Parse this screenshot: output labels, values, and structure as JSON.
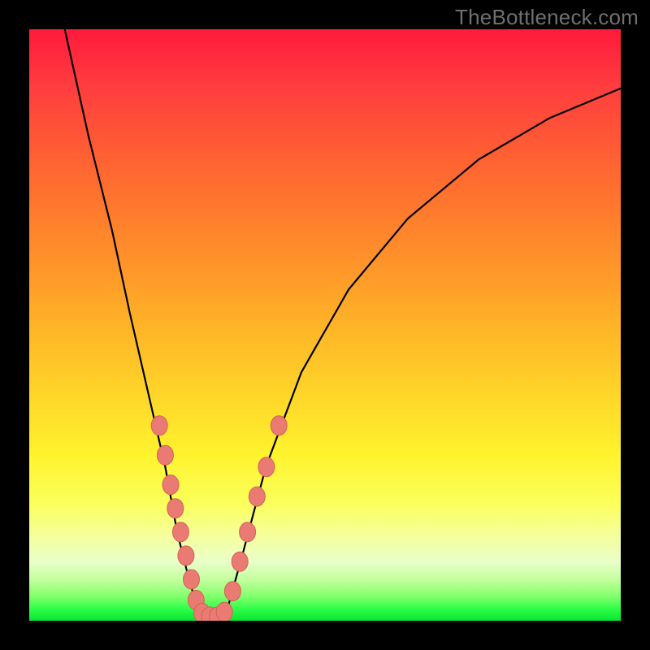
{
  "watermark": "TheBottleneck.com",
  "colors": {
    "background": "#000000",
    "curve": "#000000",
    "dot_fill": "#e97b72",
    "dot_stroke": "#d46258"
  },
  "chart_data": {
    "type": "line",
    "title": "",
    "xlabel": "",
    "ylabel": "",
    "xlim": [
      0,
      100
    ],
    "ylim": [
      0,
      100
    ],
    "note": "No axis ticks or numeric labels are rendered in the image; values below are normalized 0–100 estimates read from pixel positions. y corresponds to gradient height (0 = green bottom, 100 = red top).",
    "series": [
      {
        "name": "curve-left",
        "x": [
          6,
          10,
          14,
          17,
          20,
          23,
          25,
          27,
          28.5
        ],
        "y": [
          100,
          82,
          66,
          52,
          39,
          26,
          15,
          7,
          2
        ]
      },
      {
        "name": "curve-valley",
        "x": [
          28.5,
          30,
          32,
          33.5
        ],
        "y": [
          2,
          0.5,
          0.5,
          2
        ]
      },
      {
        "name": "curve-right",
        "x": [
          33.5,
          36,
          40,
          46,
          54,
          64,
          76,
          88,
          100
        ],
        "y": [
          2,
          11,
          26,
          42,
          56,
          68,
          78,
          85,
          90
        ]
      }
    ],
    "scatter": {
      "name": "dots",
      "points": [
        {
          "x": 22.0,
          "y": 33
        },
        {
          "x": 23.0,
          "y": 28
        },
        {
          "x": 23.9,
          "y": 23
        },
        {
          "x": 24.7,
          "y": 19
        },
        {
          "x": 25.6,
          "y": 15
        },
        {
          "x": 26.5,
          "y": 11
        },
        {
          "x": 27.4,
          "y": 7
        },
        {
          "x": 28.2,
          "y": 3.5
        },
        {
          "x": 29.2,
          "y": 1.3
        },
        {
          "x": 30.5,
          "y": 0.7
        },
        {
          "x": 31.8,
          "y": 0.7
        },
        {
          "x": 33.0,
          "y": 1.5
        },
        {
          "x": 34.4,
          "y": 5
        },
        {
          "x": 35.6,
          "y": 10
        },
        {
          "x": 36.9,
          "y": 15
        },
        {
          "x": 38.5,
          "y": 21
        },
        {
          "x": 40.1,
          "y": 26
        },
        {
          "x": 42.2,
          "y": 33
        }
      ]
    }
  }
}
